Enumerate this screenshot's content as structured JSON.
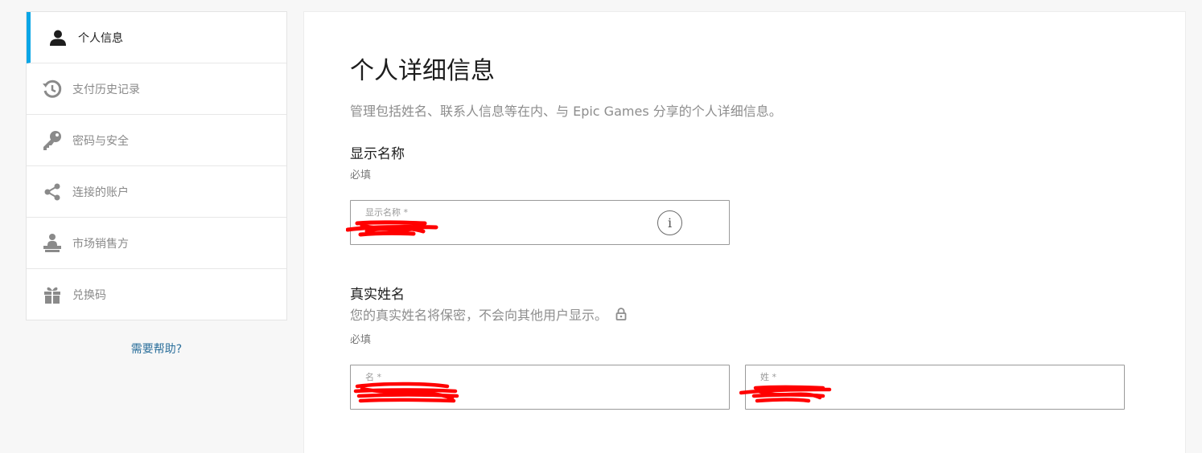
{
  "sidebar": {
    "items": [
      {
        "label": "个人信息",
        "icon": "user-icon",
        "active": true
      },
      {
        "label": "支付历史记录",
        "icon": "history-icon",
        "active": false
      },
      {
        "label": "密码与安全",
        "icon": "key-icon",
        "active": false
      },
      {
        "label": "连接的账户",
        "icon": "share-icon",
        "active": false
      },
      {
        "label": "市场销售方",
        "icon": "seller-icon",
        "active": false
      },
      {
        "label": "兑换码",
        "icon": "gift-icon",
        "active": false
      }
    ],
    "help_label": "需要帮助?"
  },
  "colors": {
    "accent": "#0aa6e6",
    "link": "#2b6f9b",
    "redaction": "#ff0000"
  },
  "main": {
    "title": "个人详细信息",
    "description": "管理包括姓名、联系人信息等在内、与 Epic Games 分享的个人详细信息。",
    "display_name": {
      "heading": "显示名称",
      "required": "必填",
      "field_label": "显示名称 *",
      "value": "",
      "info_icon": "i"
    },
    "real_name": {
      "heading": "真实姓名",
      "note": "您的真实姓名将保密，不会向其他用户显示。",
      "required": "必填",
      "first_name_label": "名 *",
      "first_name_value": "",
      "last_name_label": "姓 *",
      "last_name_value": ""
    }
  }
}
